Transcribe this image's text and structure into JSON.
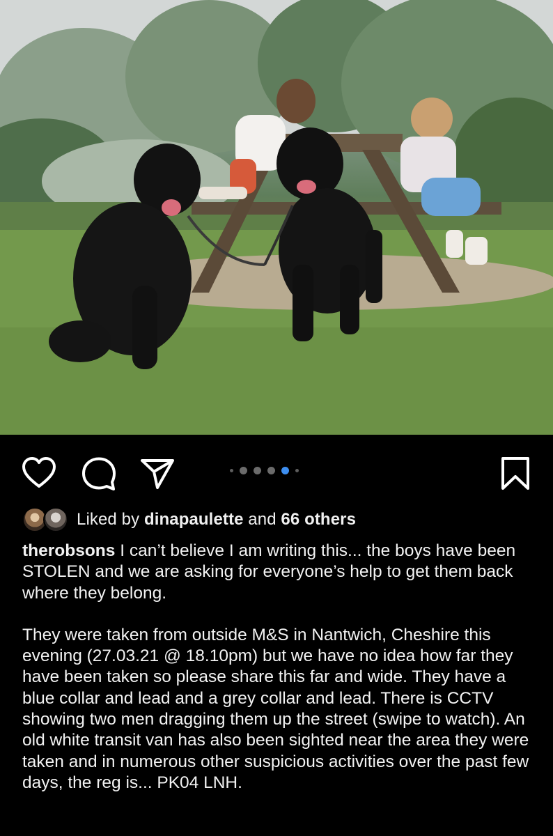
{
  "post": {
    "image_alt": "Two black Labradors sitting on grass in front of a picnic bench with two young children",
    "carousel": {
      "total": 5,
      "active_index": 3
    }
  },
  "actions": {
    "like_icon": "heart-icon",
    "comment_icon": "comment-icon",
    "share_icon": "send-icon",
    "save_icon": "bookmark-icon",
    "active_dot_color": "#3d8ef0"
  },
  "likes": {
    "prefix": "Liked by ",
    "user": "dinapaulette",
    "middle": " and ",
    "others": "66 others"
  },
  "caption": {
    "username": "therobsons",
    "paragraph1": " I can’t believe I am writing this... the boys have been STOLEN and we are asking for everyone’s help to get them back where they belong.",
    "paragraph2": "They were taken from outside M&S in Nantwich, Cheshire this evening (27.03.21 @ 18.10pm) but we have no idea how far they have been taken so please share this far and wide. They have a blue collar and lead and a grey collar and lead. There is CCTV showing two men dragging them up the street (swipe to watch). An old white transit van has also been sighted near the area they were taken and in numerous other suspicious activities over the past few days, the reg is... PK04 LNH."
  }
}
